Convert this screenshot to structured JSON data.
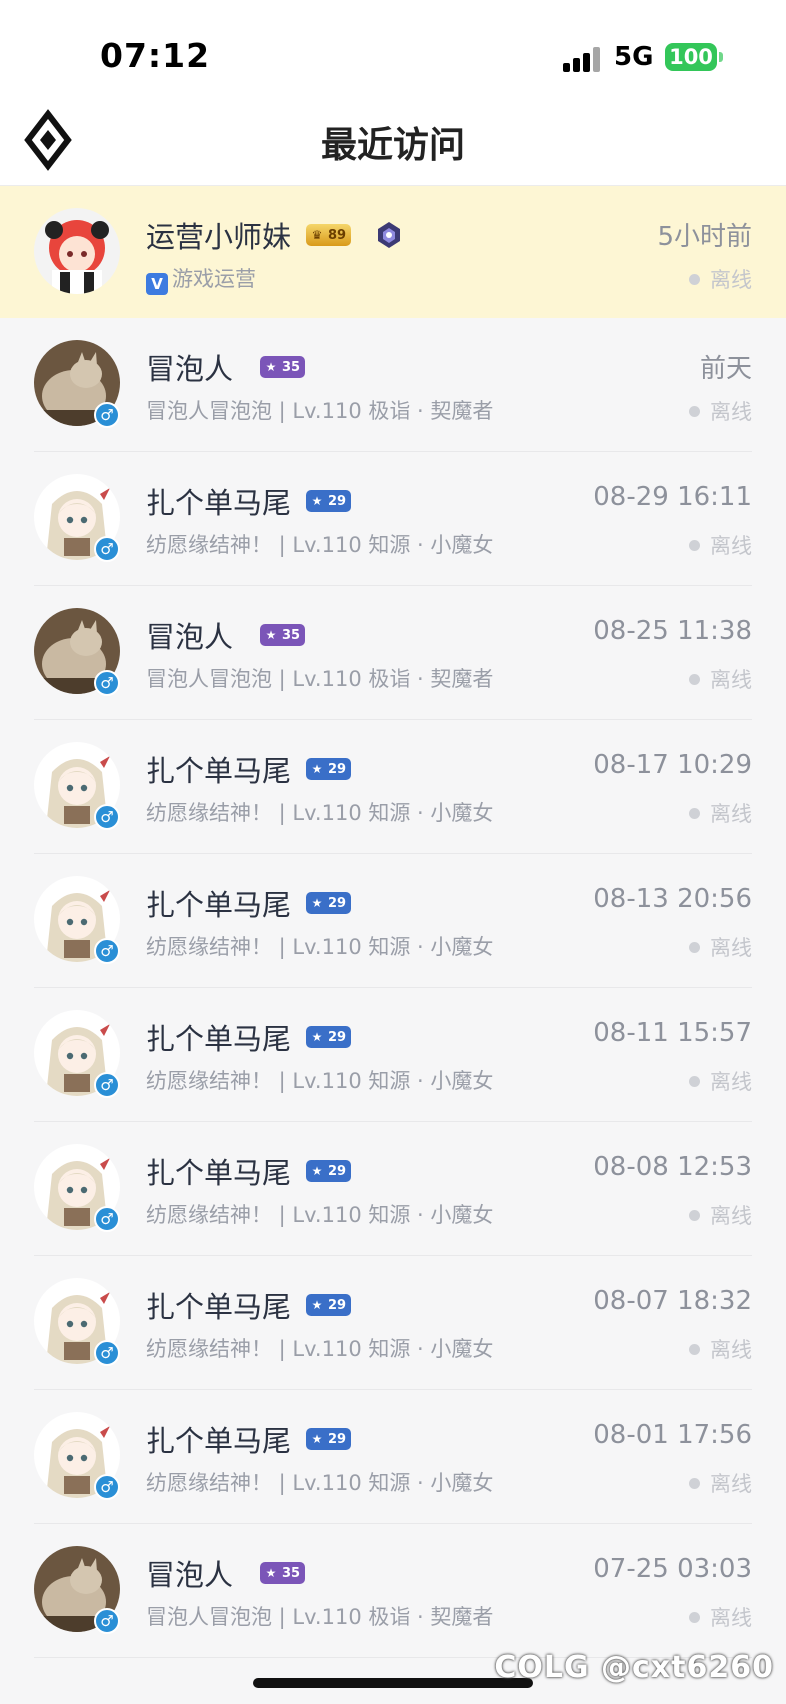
{
  "status_bar": {
    "time": "07:12",
    "network": "5G",
    "battery": "100"
  },
  "header": {
    "title": "最近访问",
    "back_icon": "diamond-logo-icon"
  },
  "visitors": [
    {
      "name": "运营小师妹",
      "badge": "89",
      "badge_style": "gold",
      "extra_icon": "rank-emblem-icon",
      "subline_prefix": "V",
      "subline": "游戏运营",
      "when": "5小时前",
      "status": "离线",
      "avatar": "red-hair-girl",
      "highlight": true
    },
    {
      "name": "冒泡人",
      "badge": "35",
      "badge_style": "purple",
      "subline": "冒泡人冒泡泡 | Lv.110 极诣 · 契魔者",
      "when": "前天",
      "status": "离线",
      "avatar": "cat",
      "gender": "♂"
    },
    {
      "name": "扎个单马尾",
      "badge": "29",
      "badge_style": "blue",
      "subline": "纺愿缘结神！ | Lv.110 知源 · 小魔女",
      "when": "08-29 16:11",
      "status": "离线",
      "avatar": "anime-girl",
      "gender": "♂"
    },
    {
      "name": "冒泡人",
      "badge": "35",
      "badge_style": "purple",
      "subline": "冒泡人冒泡泡 | Lv.110 极诣 · 契魔者",
      "when": "08-25 11:38",
      "status": "离线",
      "avatar": "cat",
      "gender": "♂"
    },
    {
      "name": "扎个单马尾",
      "badge": "29",
      "badge_style": "blue",
      "subline": "纺愿缘结神！ | Lv.110 知源 · 小魔女",
      "when": "08-17 10:29",
      "status": "离线",
      "avatar": "anime-girl",
      "gender": "♂"
    },
    {
      "name": "扎个单马尾",
      "badge": "29",
      "badge_style": "blue",
      "subline": "纺愿缘结神！ | Lv.110 知源 · 小魔女",
      "when": "08-13 20:56",
      "status": "离线",
      "avatar": "anime-girl",
      "gender": "♂"
    },
    {
      "name": "扎个单马尾",
      "badge": "29",
      "badge_style": "blue",
      "subline": "纺愿缘结神！ | Lv.110 知源 · 小魔女",
      "when": "08-11 15:57",
      "status": "离线",
      "avatar": "anime-girl",
      "gender": "♂"
    },
    {
      "name": "扎个单马尾",
      "badge": "29",
      "badge_style": "blue",
      "subline": "纺愿缘结神！ | Lv.110 知源 · 小魔女",
      "when": "08-08 12:53",
      "status": "离线",
      "avatar": "anime-girl",
      "gender": "♂"
    },
    {
      "name": "扎个单马尾",
      "badge": "29",
      "badge_style": "blue",
      "subline": "纺愿缘结神！ | Lv.110 知源 · 小魔女",
      "when": "08-07 18:32",
      "status": "离线",
      "avatar": "anime-girl",
      "gender": "♂"
    },
    {
      "name": "扎个单马尾",
      "badge": "29",
      "badge_style": "blue",
      "subline": "纺愿缘结神！ | Lv.110 知源 · 小魔女",
      "when": "08-01 17:56",
      "status": "离线",
      "avatar": "anime-girl",
      "gender": "♂"
    },
    {
      "name": "冒泡人",
      "badge": "35",
      "badge_style": "purple",
      "subline": "冒泡人冒泡泡 | Lv.110 极诣 · 契魔者",
      "when": "07-25 03:03",
      "status": "离线",
      "avatar": "cat",
      "gender": "♂"
    }
  ],
  "watermark": "COLG @cxt6260"
}
